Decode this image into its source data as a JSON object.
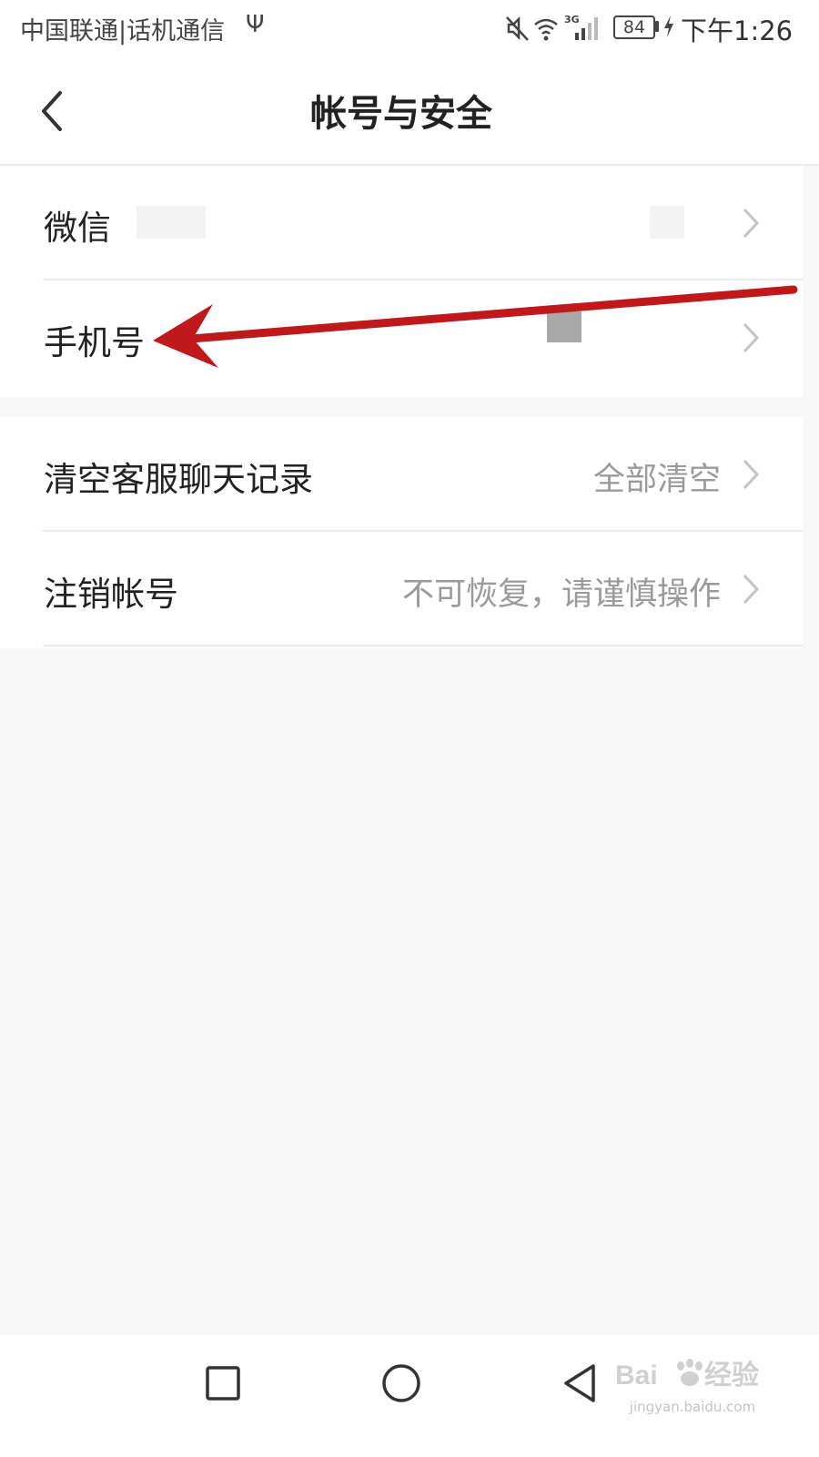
{
  "status_bar": {
    "carrier": "中国联通|话机通信",
    "battery_level": "84",
    "time": "下午1:26",
    "network_type": "3G",
    "icons": [
      "usb-icon",
      "mute-icon",
      "wifi-icon",
      "signal-icon",
      "battery-icon",
      "charging-bolt-icon"
    ]
  },
  "header": {
    "title": "帐号与安全",
    "back_icon": "chevron-left-icon"
  },
  "settings": {
    "account_group": [
      {
        "label": "微信",
        "value": ""
      },
      {
        "label": "手机号",
        "value": ""
      }
    ],
    "data_group": [
      {
        "label": "清空客服聊天记录",
        "value": "全部清空"
      },
      {
        "label": "注销帐号",
        "value": "不可恢复，请谨慎操作"
      }
    ]
  },
  "annotation": {
    "type": "red-arrow",
    "color": "#c0191b"
  },
  "nav_bar": {
    "buttons": [
      "recents-square-icon",
      "home-circle-icon",
      "back-triangle-icon"
    ]
  },
  "watermark": {
    "logo": "Baidu 经验",
    "url": "jingyan.baidu.com"
  },
  "colors": {
    "background": "#f8f8f8",
    "surface": "#ffffff",
    "divider": "#ececec",
    "primary_text": "#222222",
    "secondary_text": "#9a9a9a",
    "arrow": "#c0191b"
  }
}
